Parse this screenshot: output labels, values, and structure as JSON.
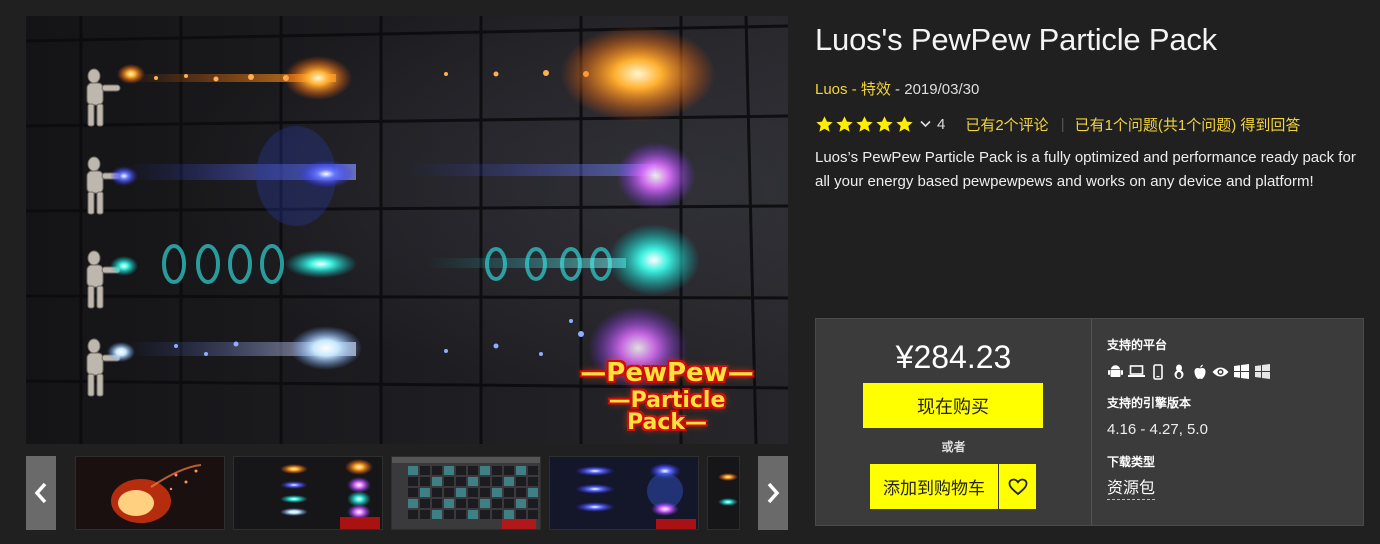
{
  "product": {
    "title": "Luos's PewPew Particle Pack",
    "publisher": "Luos",
    "category": "特效",
    "date": "2019/03/30",
    "meta_sep1": " - ",
    "meta_sep2": " - ",
    "rating": {
      "stars": 5,
      "max": 5,
      "count": "4"
    },
    "reviews_link": "已有2个评论",
    "questions_link": "已有1个问题(共1个问题) 得到回答",
    "description": "Luos’s PewPew Particle Pack is a fully optimized and performance ready pack for all your energy based pewpewpews and works on any device and platform!"
  },
  "media": {
    "logo_line1": "—PewPew—",
    "logo_line2": "—Particle Pack—",
    "thumbnails": [
      "fireball",
      "pewpew-rows",
      "grid-overview",
      "blue-rows",
      "partial"
    ],
    "prev_icon": "chevron-left-icon",
    "next_icon": "chevron-right-icon"
  },
  "purchase": {
    "price": "¥284.23",
    "buy_now": "现在购买",
    "or": "或者",
    "add_to_cart": "添加到购物车",
    "wishlist_icon": "heart-icon",
    "platforms_label": "支持的平台",
    "platform_icons": [
      "android-icon",
      "laptop-icon",
      "mobile-icon",
      "linux-icon",
      "apple-icon",
      "eye-icon",
      "windows-icon",
      "windows-store-icon"
    ],
    "engine_label": "支持的引擎版本",
    "engine_versions": "4.16 - 4.27, 5.0",
    "download_label": "下载类型",
    "download_type": "资源包"
  },
  "colors": {
    "accent_yellow": "#ffff00",
    "link_yellow": "#f2d43b",
    "panel": "#3b3b3b",
    "background": "#202020"
  }
}
